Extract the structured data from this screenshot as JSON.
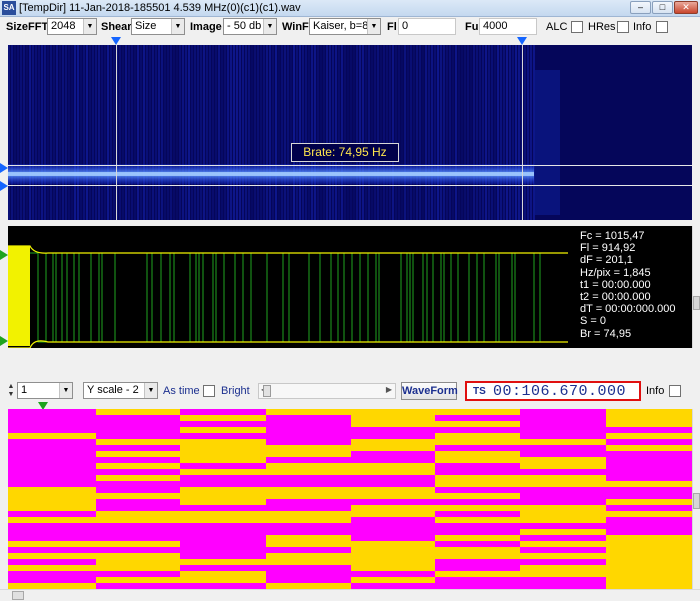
{
  "window": {
    "app_icon_text": "SA",
    "title": "[TempDir] 11-Jan-2018-185501 4.539 MHz(0)(c1)(c1).wav",
    "minimize": "–",
    "maximize": "□",
    "close": "✕"
  },
  "toolbar": {
    "sizefft_label": "SizeFFT",
    "sizefft_value": "2048",
    "shear_label": "Shear",
    "shear_value": "Size",
    "image_label": "Image",
    "image_value": "- 50 db",
    "winf_label": "WinF",
    "winf_value": "Kaiser, b=8",
    "fl_label": "Fl",
    "fl_value": "0",
    "fu_label": "Fu",
    "fu_value": "4000",
    "alc_label": "ALC",
    "hres_label": "HRes",
    "info_label": "Info"
  },
  "spectrogram": {
    "brate_label": "Brate: 74,95 Hz"
  },
  "measurements": {
    "fc": "Fc = 1015,47",
    "fl": "Fl = 914,92",
    "df": "dF = 201,1",
    "hzpix": "Hz/pix = 1,845",
    "t1": "t1 = 00:00.000",
    "t2": "t2 = 00:00.000",
    "dt": "dT = 00:00:000.000",
    "s": "S = 0",
    "br": "Br = 74,95"
  },
  "controls": {
    "spin_value": "1",
    "yscale_value": "Y scale - 2",
    "astime_label": "As time",
    "bright_label": "Bright",
    "waveform_button": "WaveForm",
    "ts_label": "TS",
    "ts_value": "00:106.670.000",
    "info_label": "Info"
  },
  "colors": {
    "bit_one": "#ffd700",
    "bit_zero": "#ff00ff",
    "highlight_border": "#e01010",
    "wave_green": "#1fa31f",
    "wave_yellow": "#f2f200"
  }
}
